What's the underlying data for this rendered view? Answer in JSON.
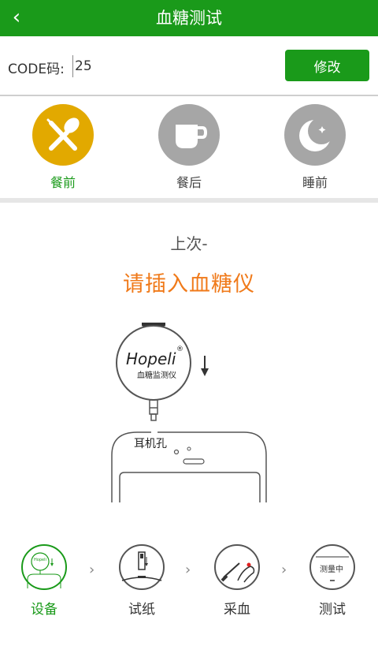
{
  "header": {
    "back_icon": "chevron-left-icon",
    "title": "血糖测试"
  },
  "code": {
    "label": "CODE码:",
    "value": "25",
    "button": "修改"
  },
  "meals": [
    {
      "label": "餐前",
      "icon": "fork-spoon-icon",
      "active": true
    },
    {
      "label": "餐后",
      "icon": "cup-icon",
      "active": false
    },
    {
      "label": "睡前",
      "icon": "moon-icon",
      "active": false
    }
  ],
  "status": {
    "last": "上次-",
    "prompt": "请插入血糖仪"
  },
  "illustration": {
    "brand": "Hopeli",
    "registered": "®",
    "device": "血糖监测仪",
    "port": "耳机孔"
  },
  "steps": [
    {
      "label": "设备",
      "active": true,
      "inner": "Hopeli"
    },
    {
      "label": "试纸",
      "active": false
    },
    {
      "label": "采血",
      "active": false
    },
    {
      "label": "测试",
      "active": false,
      "inner": "测量中"
    }
  ],
  "colors": {
    "brand_green": "#1a9a1a",
    "accent_orange": "#f07a1a",
    "active_meal": "#e2a900"
  }
}
